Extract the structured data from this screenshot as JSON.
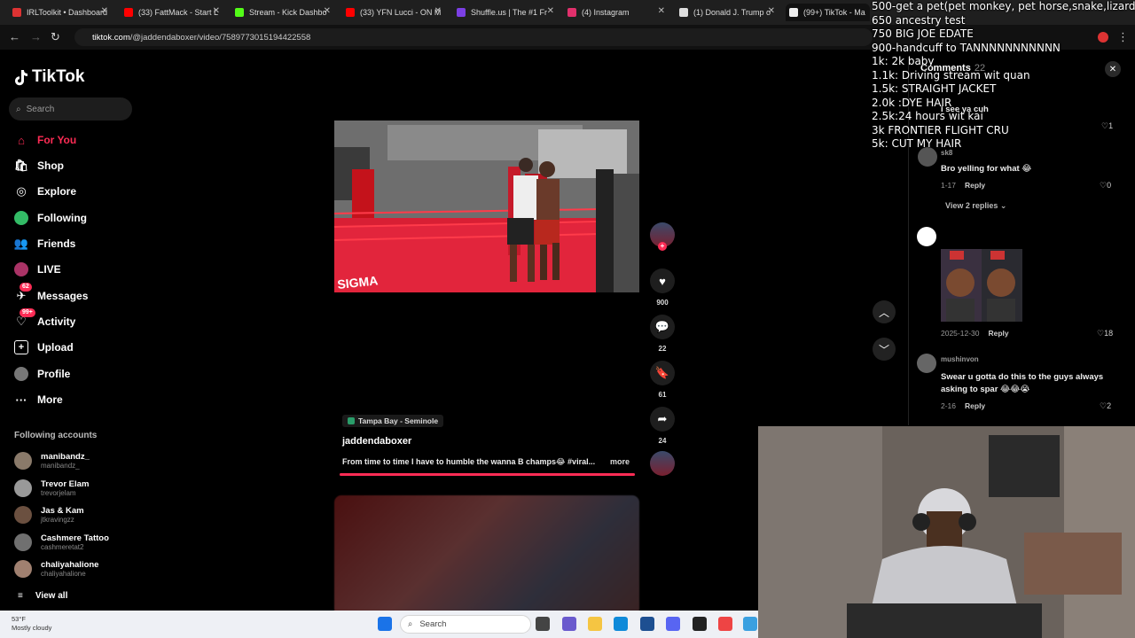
{
  "browser": {
    "tabs": [
      {
        "title": "IRLToolkit • Dashboard",
        "color": "#d33"
      },
      {
        "title": "(33) FattMack - Start L",
        "color": "#f00"
      },
      {
        "title": "Stream - Kick Dashbo",
        "color": "#53fc18"
      },
      {
        "title": "(33) YFN Lucci - ON M",
        "color": "#f00"
      },
      {
        "title": "Shuffle.us | The #1 Fr",
        "color": "#7b3fe4"
      },
      {
        "title": "(4) Instagram",
        "color": "#e1306c"
      },
      {
        "title": "(1) Donald J. Trump o",
        "color": "#fff"
      },
      {
        "title": "(99+) TikTok - Ma",
        "color": "#fff"
      }
    ],
    "url_domain": "tiktok.com",
    "url_path": "/@jaddendaboxer/video/7589773015194422558"
  },
  "sidebar": {
    "logo": "TikTok",
    "search_placeholder": "Search",
    "nav": [
      {
        "label": "For You",
        "icon": "home-icon"
      },
      {
        "label": "Shop",
        "icon": "shop-icon"
      },
      {
        "label": "Explore",
        "icon": "compass-icon"
      },
      {
        "label": "Following",
        "icon": "following-icon"
      },
      {
        "label": "Friends",
        "icon": "friends-icon"
      },
      {
        "label": "LIVE",
        "icon": "live-icon"
      },
      {
        "label": "Messages",
        "icon": "messages-icon",
        "badge": "62"
      },
      {
        "label": "Activity",
        "icon": "activity-icon",
        "badge": "99+"
      },
      {
        "label": "Upload",
        "icon": "upload-icon"
      },
      {
        "label": "Profile",
        "icon": "profile-icon"
      },
      {
        "label": "More",
        "icon": "more-icon"
      }
    ],
    "following_title": "Following accounts",
    "following": [
      {
        "name": "manibandz_",
        "handle": "manibandz_"
      },
      {
        "name": "Trevor Elam",
        "handle": "trevorjelam"
      },
      {
        "name": "Jas & Kam",
        "handle": "jtkravingzz"
      },
      {
        "name": "Cashmere Tattoo",
        "handle": "cashmeretat2"
      },
      {
        "name": "chaliyahalione",
        "handle": "chaliyahalione"
      }
    ],
    "view_all": "View all"
  },
  "video": {
    "location": "Tampa Bay - Seminole",
    "author": "jaddendaboxer",
    "caption": "From time to time I have to humble the wanna B champs😂 #viral...",
    "more": "more",
    "progress": 1.0
  },
  "actions": {
    "likes": "900",
    "comments": "22",
    "saves": "61",
    "shares": "24"
  },
  "comments": {
    "title": "Comments",
    "count": "22",
    "items": [
      {
        "user": "",
        "text": "I see ya cuh",
        "meta": "",
        "reply": "",
        "likes": "1"
      },
      {
        "user": "sk8",
        "text": "Bro yelling for what 😂",
        "meta": "1-17",
        "reply": "Reply",
        "likes": "0"
      },
      {
        "user": "",
        "text": "",
        "meta": "2025-12-30",
        "reply": "Reply",
        "likes": "18"
      },
      {
        "user": "mushinvon",
        "text": "Swear u gotta do this to the guys always asking to spar 😂😂😭",
        "meta": "2-16",
        "reply": "Reply",
        "likes": "2"
      }
    ],
    "view_replies": "View 2 replies"
  },
  "overlay_goals": [
    "500-get a pet(pet monkey, pet horse,snake,lizard)",
    "650 ancestry test",
    "750 BIG JOE EDATE",
    "900-handcuff to TANNNNNNNNNNN",
    "1k: 2k baby",
    "1.1k: Driving stream wit quan",
    "1.5k: STRAIGHT JACKET",
    "2.0k :DYE HAIR",
    "2.5k:24 hours wit kai",
    "3k FRONTIER FLIGHT CRU",
    "5k: CUT MY HAIR"
  ],
  "taskbar": {
    "temp": "53°F",
    "weather": "Mostly cloudy",
    "search": "Search"
  }
}
